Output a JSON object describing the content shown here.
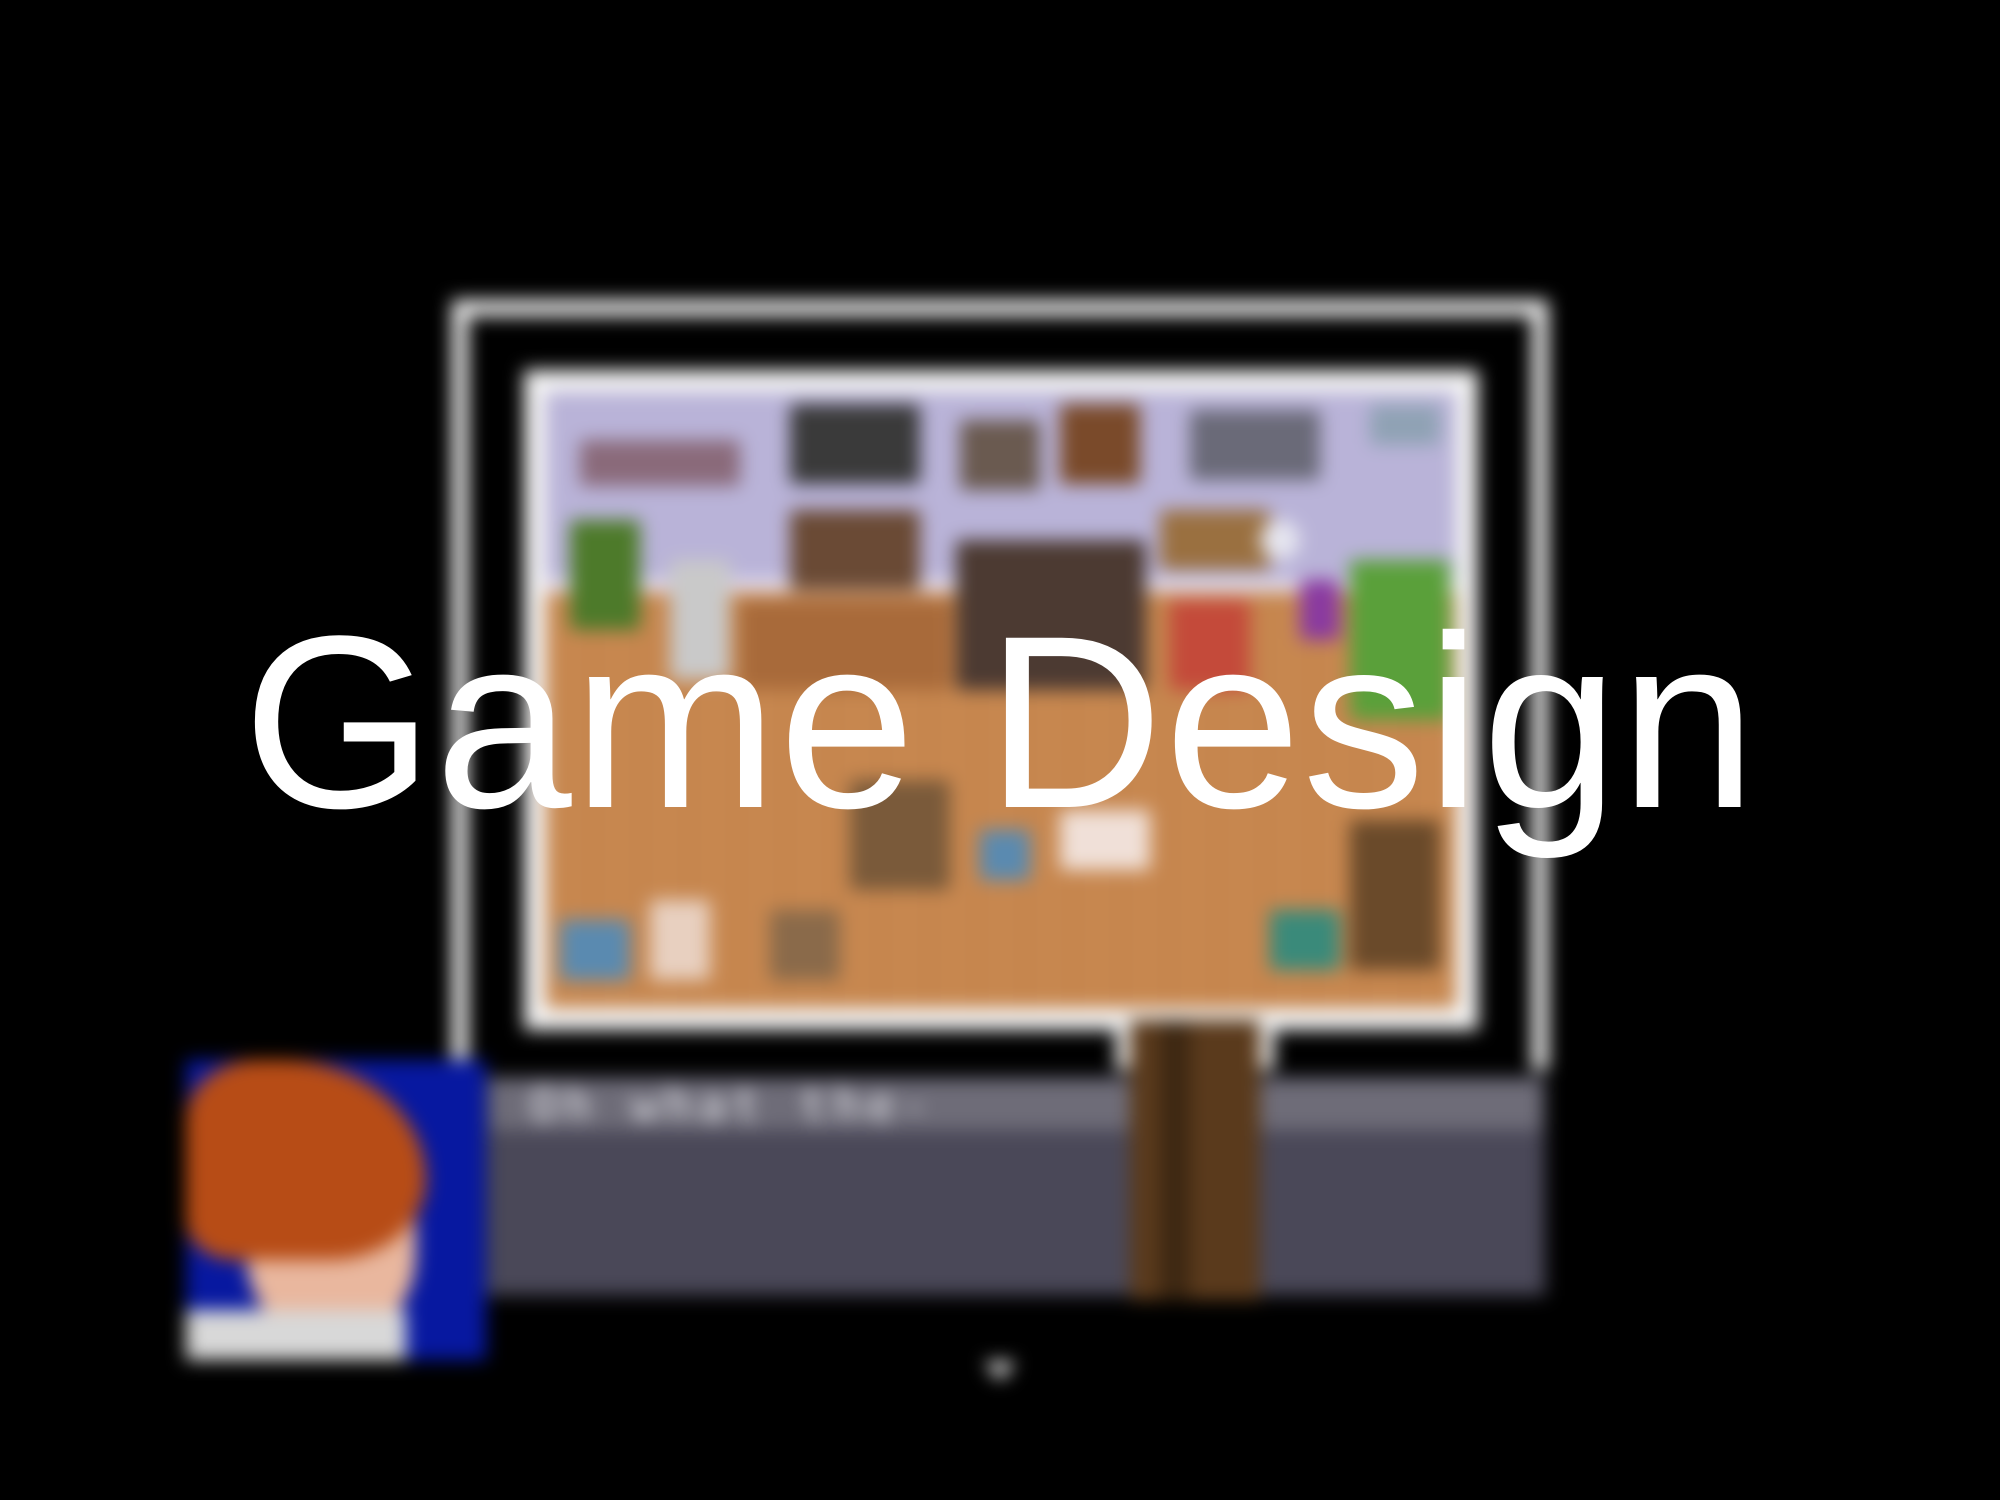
{
  "screen": {
    "headline": "Game Design",
    "dialogue_text": "Oh what the-",
    "advance_icon": "down-triangle-icon"
  },
  "colors": {
    "background": "#000000",
    "frame": "#f2f2f2",
    "wall": "#b9b3d8",
    "floor": "#c7874f",
    "message_box": "#4a4858",
    "portrait_bg": "#0718a0"
  }
}
